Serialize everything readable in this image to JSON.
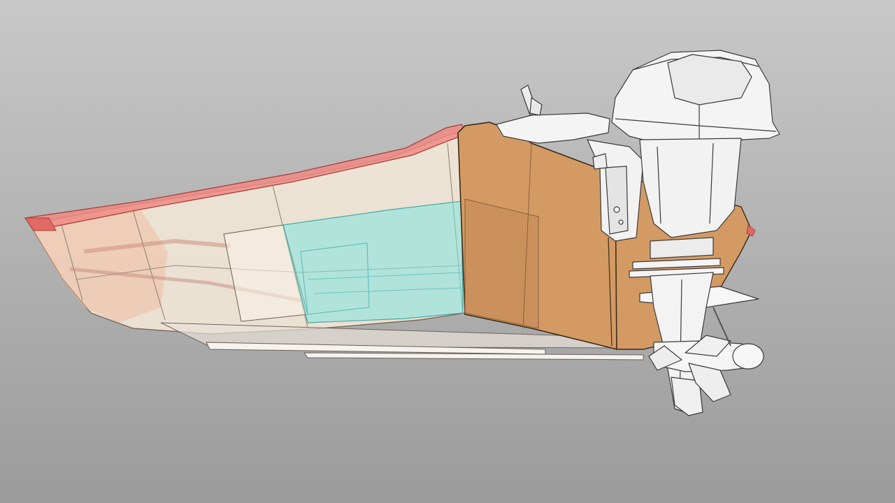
{
  "viewport": {
    "model": "boat-hull-with-outboard-motor",
    "background_color": "#b4b4b4"
  },
  "colors": {
    "gunwale": "#f08a84",
    "hull_glass": "#f4ead8",
    "hull_tint": "#f2b59a",
    "tank": "#7fe6e0",
    "transom": "#d49a64",
    "motor": "#f4f4f4",
    "outline": "#3a3a3a"
  }
}
